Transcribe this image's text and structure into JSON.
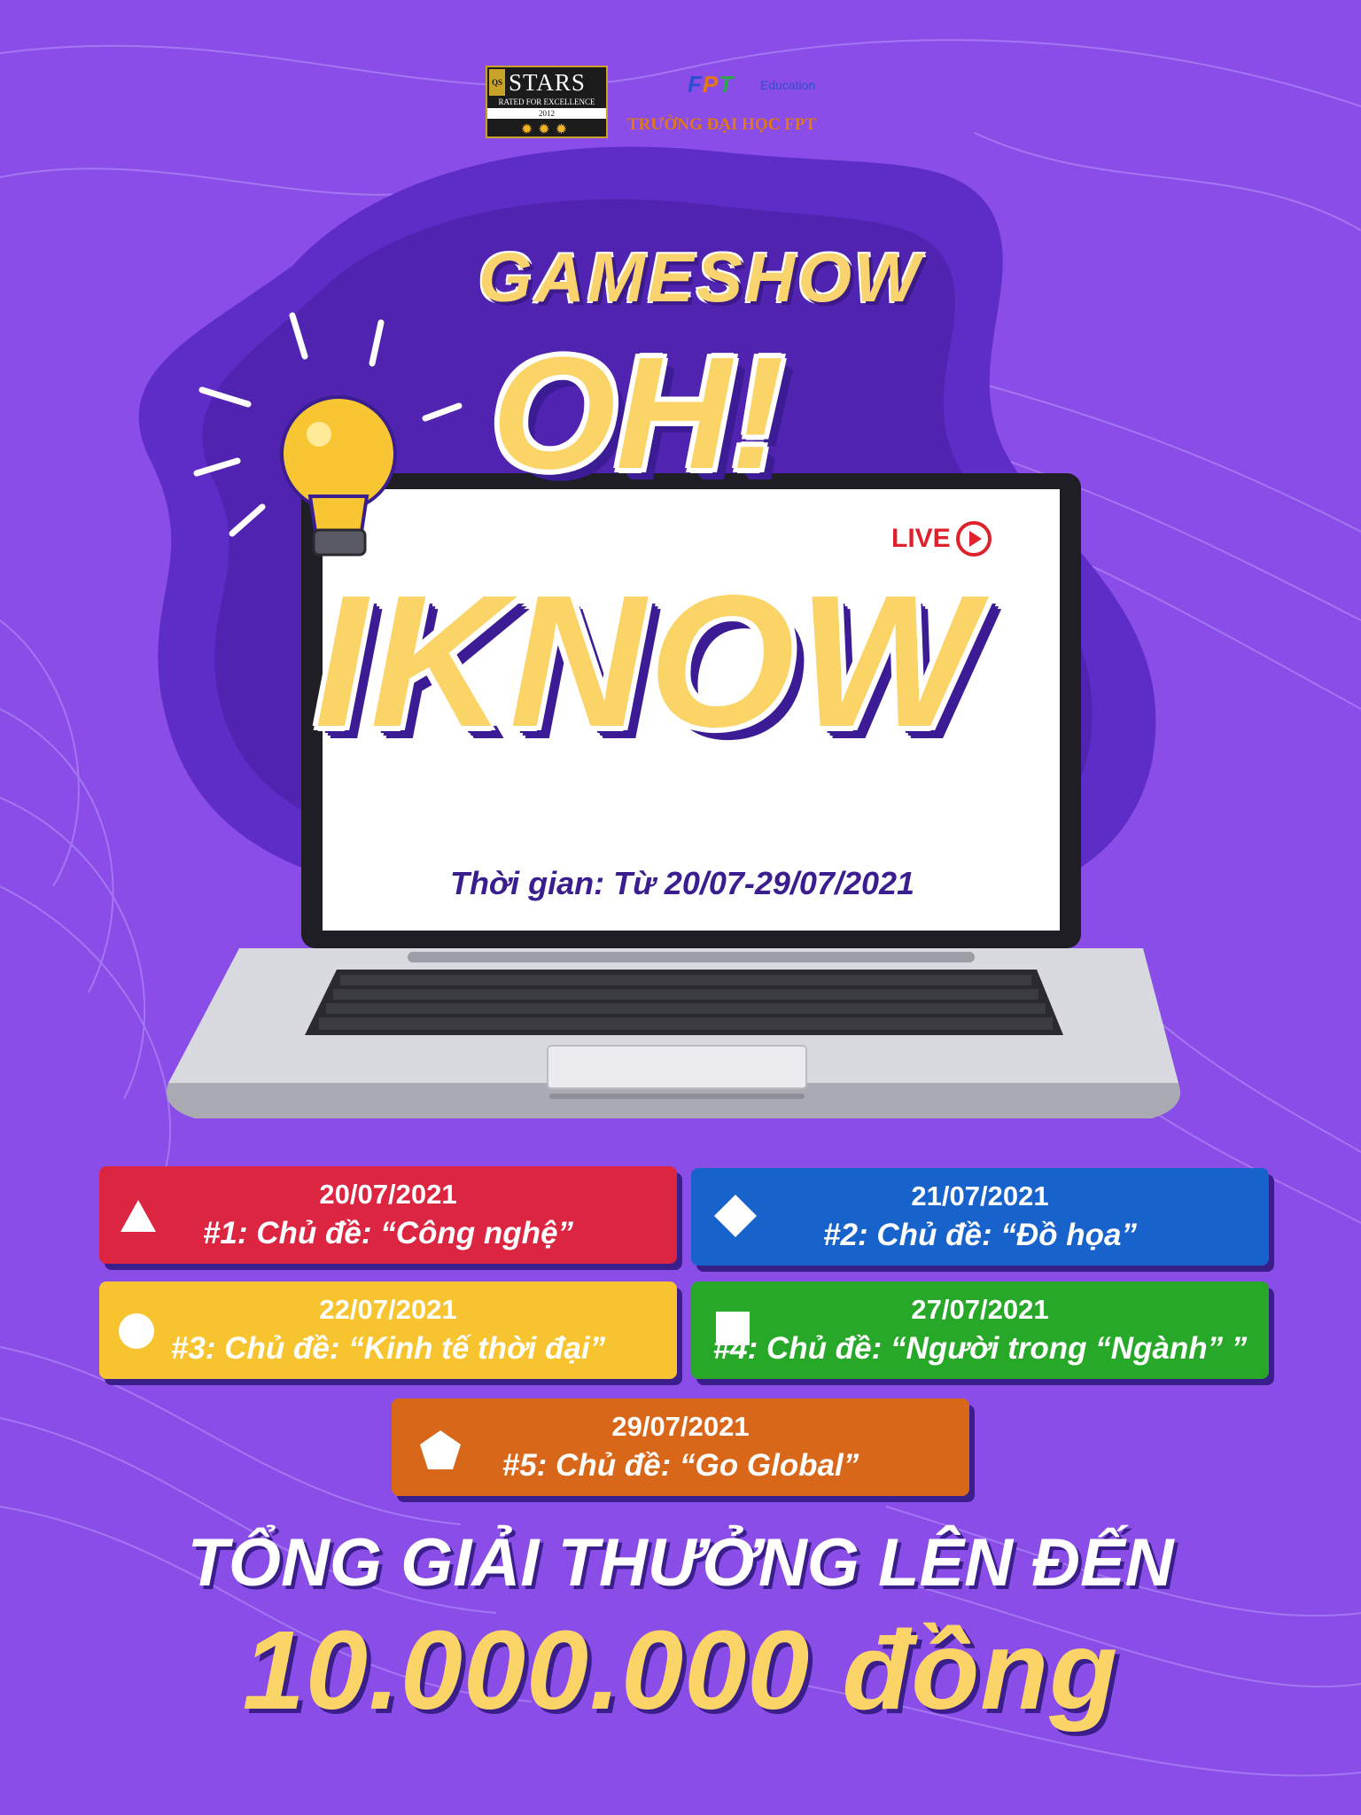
{
  "colors": {
    "background": "#8a4de8",
    "blob": "#5d2cc4",
    "title_yellow": "#fbd468",
    "title_outline": "#3b1c94",
    "card_red": "#dc2541",
    "card_blue": "#1862cc",
    "card_yellow": "#f7c42f",
    "card_green": "#27a828",
    "card_orange": "#d8671a"
  },
  "logos": {
    "qs": {
      "mark": "QS",
      "stars": "STARS",
      "rated": "RATED FOR EXCELLENCE",
      "year": "2012",
      "badge_icon": "three-stars-icon"
    },
    "fpt": {
      "letters": [
        "F",
        "P",
        "T"
      ],
      "edu": "Education",
      "school": "TRƯỜNG ĐẠI HỌC FPT"
    }
  },
  "hero": {
    "gameshow": "GAMESHOW",
    "oh": "OH!",
    "iknow": "IKNOW",
    "time": "Thời gian: Từ 20/07-29/07/2021",
    "live": "LIVE",
    "icons": [
      "lightbulb-icon",
      "laptop-illustration",
      "play-circle-icon"
    ]
  },
  "schedule": [
    {
      "date": "20/07/2021",
      "topic": "#1: Chủ đề: “Công nghệ”",
      "shape_icon": "triangle-icon"
    },
    {
      "date": "21/07/2021",
      "topic": "#2: Chủ đề: “Đồ họa”",
      "shape_icon": "diamond-icon"
    },
    {
      "date": "22/07/2021",
      "topic": "#3: Chủ đề: “Kinh tế thời đại”",
      "shape_icon": "circle-icon"
    },
    {
      "date": "27/07/2021",
      "topic": "#4: Chủ đề: “Người trong “Ngành” ”",
      "shape_icon": "square-icon"
    },
    {
      "date": "29/07/2021",
      "topic": "#5: Chủ đề: “Go Global”",
      "shape_icon": "pentagon-icon"
    }
  ],
  "prize": {
    "line1": "TỔNG GIẢI THƯỞNG LÊN ĐẾN",
    "line2": "10.000.000 đồng"
  }
}
